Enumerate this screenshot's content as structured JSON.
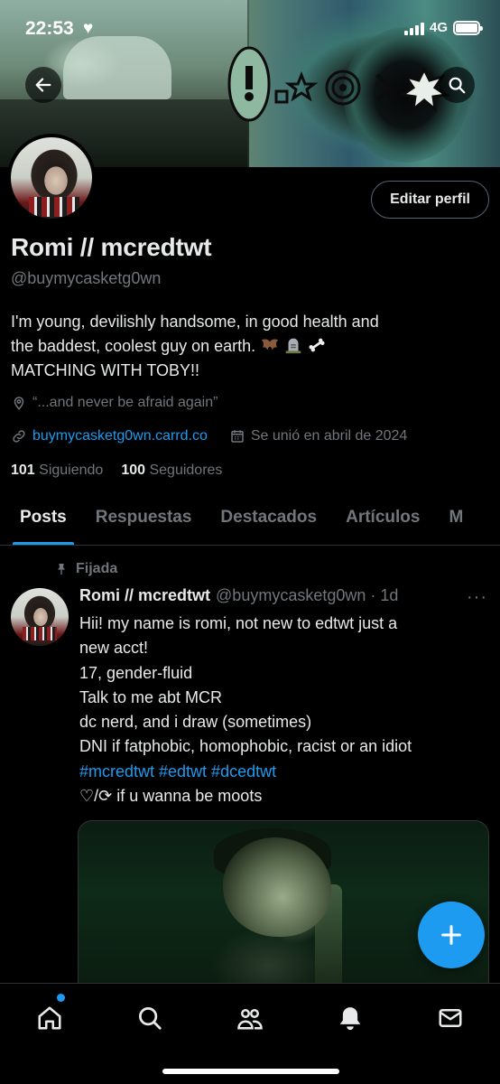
{
  "status_bar": {
    "time": "22:53",
    "network": "4G"
  },
  "profile": {
    "edit_button": "Editar perfil",
    "display_name": "Romi // mcredtwt",
    "handle": "@buymycasketg0wn",
    "bio_line1": "I'm young, devilishly handsome, in good health and",
    "bio_line2": "the baddest, coolest guy on earth.",
    "bio_line3": "MATCHING WITH TOBY!!",
    "location": "“...and never be afraid again”",
    "website": "buymycasketg0wn.carrd.co",
    "joined": "Se unió en abril de 2024",
    "following_count": "101",
    "following_label": "Siguiendo",
    "followers_count": "100",
    "followers_label": "Seguidores"
  },
  "tabs": [
    "Posts",
    "Respuestas",
    "Destacados",
    "Artículos",
    "M"
  ],
  "post": {
    "pinned_label": "Fijada",
    "author_name": "Romi // mcredtwt",
    "author_handle": "@buymycasketg0wn · 1d",
    "more": "···",
    "lines": [
      "Hii! my name is romi, not new to edtwt just a",
      "new acct!",
      "17, gender-fluid",
      "Talk to me abt MCR",
      "dc nerd, and i draw (sometimes)",
      "DNI if fatphobic, homophobic, racist or an idiot"
    ],
    "hashtags": "#mcredtwt #edtwt #dcedtwt",
    "last_line": "♡/⟳ if u wanna be moots"
  },
  "colors": {
    "accent": "#1d9bf0",
    "muted": "#71767b",
    "text": "#e7e9ea",
    "background": "#000000"
  }
}
